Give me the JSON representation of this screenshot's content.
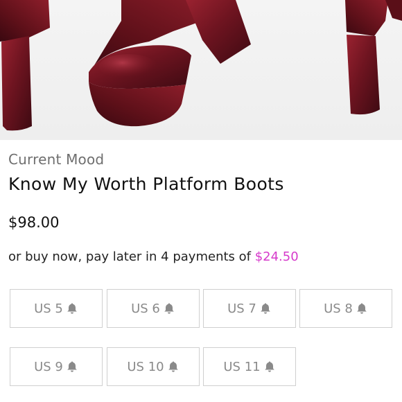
{
  "product": {
    "brand": "Current Mood",
    "title": "Know My Worth Platform Boots",
    "price": "$98.00",
    "installment_prefix": "or buy now, pay later in 4 payments of ",
    "installment_amount": "$24.50"
  },
  "sizes": [
    {
      "label": "US 5",
      "icon": "bell-icon",
      "available": false
    },
    {
      "label": "US 6",
      "icon": "bell-icon",
      "available": false
    },
    {
      "label": "US 7",
      "icon": "bell-icon",
      "available": false
    },
    {
      "label": "US 8",
      "icon": "bell-icon",
      "available": false
    },
    {
      "label": "US 9",
      "icon": "bell-icon",
      "available": false
    },
    {
      "label": "US 10",
      "icon": "bell-icon",
      "available": false
    },
    {
      "label": "US 11",
      "icon": "bell-icon",
      "available": false
    }
  ],
  "colors": {
    "accent": "#d63acb",
    "boot": "#7a1622",
    "border": "#cfcfcf",
    "muted_text": "#8a8a8a"
  }
}
